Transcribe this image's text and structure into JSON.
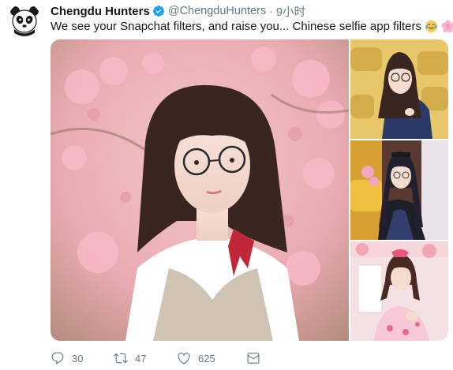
{
  "tweet": {
    "display_name": "Chengdu Hunters",
    "handle": "@ChengduHunters",
    "separator": "·",
    "time": "9小时",
    "text": "We see your Snapchat filters, and raise you... Chinese selfie app filters",
    "emojis": [
      "face-with-tears-of-joy-icon",
      "cherry-blossom-icon"
    ],
    "verified": true
  },
  "media": {
    "photo_count": 4
  },
  "actions": {
    "replies": "30",
    "retweets": "47",
    "likes": "625"
  },
  "colors": {
    "verified_blue": "#1da1f2",
    "secondary_text": "#657786",
    "primary_text": "#14171a"
  }
}
